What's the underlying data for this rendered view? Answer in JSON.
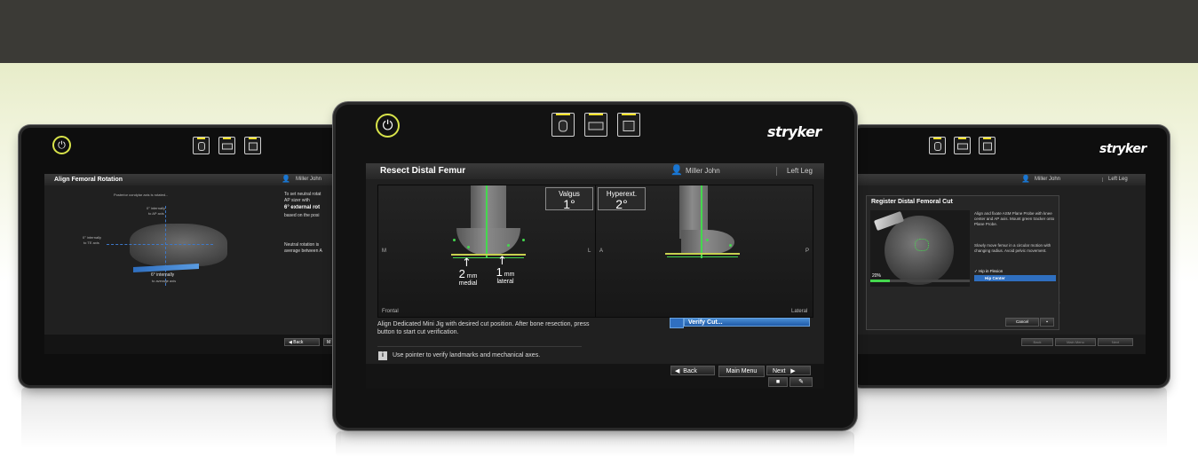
{
  "brand": "stryker",
  "center": {
    "header_icons": [
      "mouse-icon",
      "keyboard-icon",
      "touch-icon"
    ],
    "title": "Resect Distal Femur",
    "user": "Miller John",
    "leg": "Left Leg",
    "frontal": {
      "view_label": "Frontal",
      "side_left": "M",
      "side_right": "L",
      "valgus_label": "Valgus",
      "valgus_value": "1°",
      "medial_value": "2",
      "medial_unit": "mm",
      "medial_label": "medial",
      "lateral_value": "1",
      "lateral_unit": "mm",
      "lateral_label": "lateral"
    },
    "lateral": {
      "view_label": "Lateral",
      "side_left": "A",
      "side_right": "P",
      "hyperext_label": "Hyperext.",
      "hyperext_value": "2°"
    },
    "instruction": "Align Dedicated Mini Jig with desired cut position. After bone resection, press button to start cut verification.",
    "verify_label": "Verify Cut...",
    "hint": "Use pointer to verify landmarks and mechanical axes.",
    "nav": {
      "back": "Back",
      "main_menu": "Main Menu",
      "next": "Next"
    }
  },
  "left": {
    "title": "Align Femoral Rotation",
    "user": "Miller John",
    "fig_top": "Posterior condylar axis is rotated...",
    "fig_a": "0° internally",
    "fig_a2": "to AP axis",
    "fig_b": "0° internally",
    "fig_b2": "to TE axis",
    "fig_c": "6° internally",
    "fig_c2": "to average axis",
    "text1a": "To set neutral rotat",
    "text1b": "AP sizer with",
    "text1c": "6° external rot",
    "text1d": "based on the posi",
    "text2a": "Neutral rotation is",
    "text2b": "average between A",
    "back": "Back",
    "menu_cut": "M"
  },
  "right": {
    "user": "Miller John",
    "leg": "Left Leg",
    "dialog_title": "Register Distal Femoral Cut",
    "dialog_text1": "Align and fixate ASM Plane Probe with knee center and AP axis. Mount green tracker onto Plane Probe.",
    "dialog_text2": "Slowly move femur in a circular motion with changing radius. Avoid pelvic movement.",
    "progress_label": "20%",
    "progress_value": 0.2,
    "check1": "Hip in Flexion",
    "check2": "Hip Center",
    "cancel": "Cancel",
    "nav_back": "Back",
    "nav_menu": "Main Menu",
    "nav_next": "Next"
  },
  "colors": {
    "accent_blue": "#2f6fc0",
    "accent_green": "#44d84e",
    "power_ring": "#d8e34a"
  }
}
